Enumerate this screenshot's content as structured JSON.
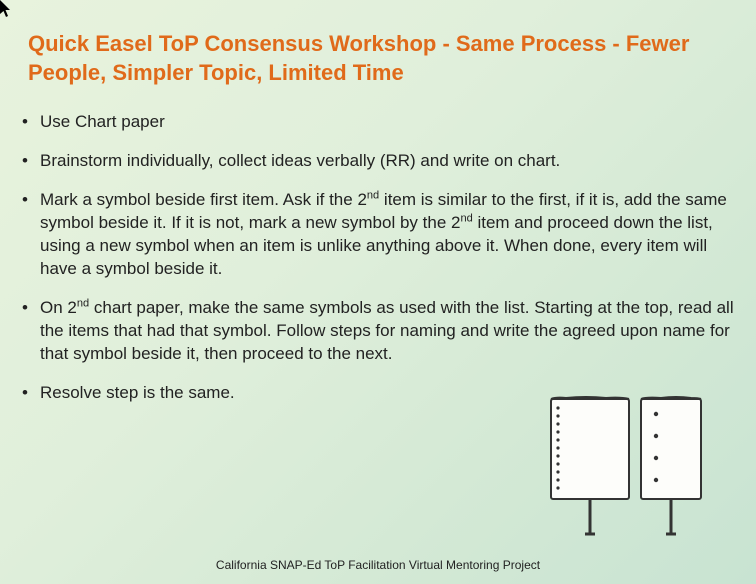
{
  "title": "Quick Easel ToP Consensus Workshop - Same Process - Fewer People, Simpler Topic, Limited Time",
  "bullets": [
    "Use Chart paper",
    "Brainstorm individually, collect ideas verbally (RR) and write on chart.",
    "Mark a symbol beside first item. Ask if the 2<sup>nd</sup> item is similar to the first, if it is, add the same symbol beside it.  If it is not, mark a new symbol by the 2<sup>nd</sup> item and proceed down the list, using a new symbol when an item is unlike anything above it.  When done, every item will have a symbol beside it.",
    "On 2<sup>nd</sup> chart paper, make the same symbols as used with the list.  Starting at the top, read all the items that had that symbol.  Follow steps for naming and write the agreed upon name for that symbol beside it, then proceed to the next.",
    "Resolve step is the same."
  ],
  "footer": "California SNAP-Ed ToP Facilitation Virtual Mentoring Project",
  "icons": {
    "cursor": "cursor-arrow-icon",
    "easel_left": "easel-chart-left-icon",
    "easel_right": "easel-chart-right-icon"
  }
}
